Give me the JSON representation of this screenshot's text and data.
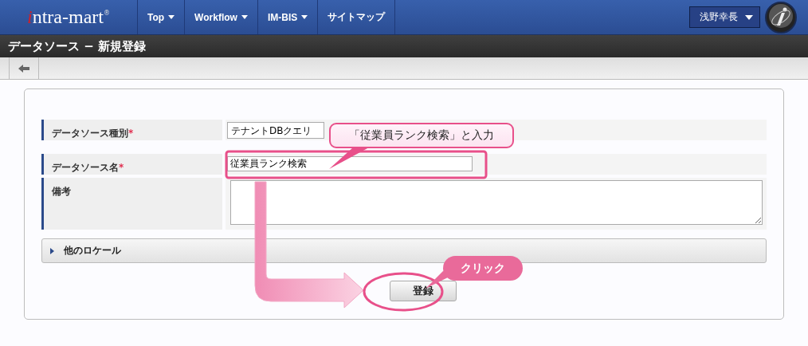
{
  "nav": {
    "logo": "intra-mart",
    "logo_mark": "®",
    "menus": [
      {
        "label": "Top",
        "dropdown": true
      },
      {
        "label": "Workflow",
        "dropdown": true
      },
      {
        "label": "IM-BIS",
        "dropdown": true
      },
      {
        "label": "サイトマップ",
        "dropdown": false
      }
    ],
    "user": "浅野幸長"
  },
  "page_title": "データソース − 新規登録",
  "form": {
    "fields": [
      {
        "label": "データソース種別",
        "required_mark": "*",
        "kind": "select",
        "value": "テナントDBクエリ"
      },
      {
        "label": "データソース名",
        "required_mark": "*",
        "kind": "text",
        "value": "従業員ランク検索"
      },
      {
        "label": "備考",
        "kind": "textarea"
      }
    ]
  },
  "section": {
    "label": "他のロケール",
    "expanded": false
  },
  "submit": "登録",
  "annotations": [
    {
      "kind": "callout",
      "text": "「従業員ランク検索」と入力"
    },
    {
      "kind": "badge",
      "text": "クリック"
    }
  ]
}
